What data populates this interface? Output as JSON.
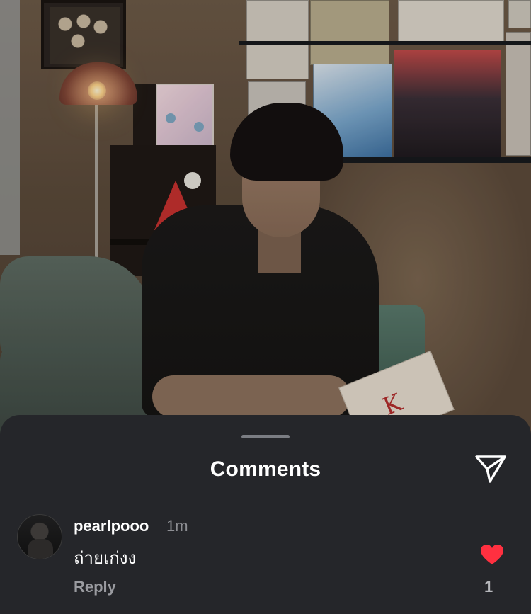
{
  "sheet": {
    "title": "Comments",
    "share_icon": "send-paper-plane-icon"
  },
  "comments": [
    {
      "username": "pearlpooo",
      "time": "1m",
      "text": "ถ่ายเก่งง",
      "reply_label": "Reply",
      "like_icon": "heart-filled-icon",
      "like_color": "#ff3040",
      "like_count": "1"
    }
  ],
  "colors": {
    "sheet_background": "#25262a",
    "text_primary": "#ffffff",
    "text_secondary": "#8e8f94",
    "like_red": "#ff3040"
  }
}
